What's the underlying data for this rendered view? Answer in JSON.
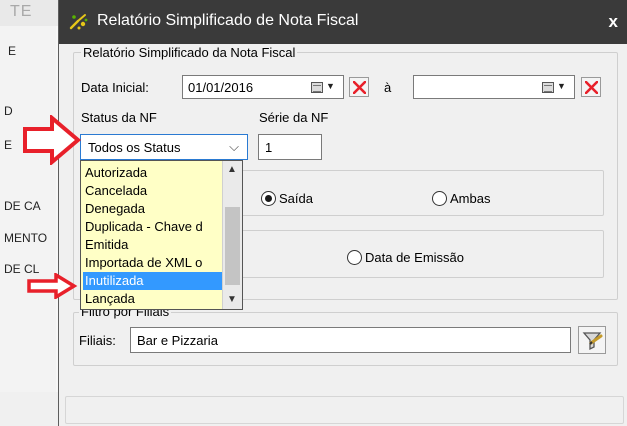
{
  "background": {
    "top_label": "TE",
    "items": [
      "E",
      "D",
      "E",
      "DE CA",
      "MENTO",
      "DE CL"
    ]
  },
  "dialog": {
    "title": "Relatório Simplificado de Nota Fiscal",
    "close_glyph": "x",
    "group_title": "Relatório Simplificado da Nota Fiscal",
    "data_inicial_label": "Data Inicial:",
    "data_inicial_value": "01/01/2016",
    "a_label": "à",
    "data_final_value": "",
    "status_label": "Status da NF",
    "status_selected": "Todos os Status",
    "serie_label": "Série da NF",
    "serie_value": "1",
    "status_options": [
      "Autorizada",
      "Cancelada",
      "Denegada",
      "Duplicada - Chave d",
      "Emitida",
      "Importada de XML o",
      "Inutilizada",
      "Lançada"
    ],
    "highlighted_option": "Inutilizada",
    "radio_saida": "Saída",
    "radio_ambas": "Ambas",
    "radio_data_emissao": "Data de Emissão",
    "filtro_title": "Filtro por Filiais",
    "filiais_label": "Filiais:",
    "filiais_value": "Bar e Pizzaria"
  },
  "colors": {
    "titlebar": "#3a3a3a",
    "dialog_bg": "#f0f0f0",
    "listbox_bg": "#ffffc6",
    "selection": "#3399ff",
    "annotation_arrow": "#e8202a",
    "delete_x": "#e8202a"
  },
  "icons": [
    "app-logo-icon",
    "close-icon",
    "calendar-icon",
    "dropdown-arrow-icon",
    "clear-x-icon",
    "chevron-down-icon",
    "scroll-up-icon",
    "scroll-down-icon",
    "filter-icon",
    "annotation-arrow-icon"
  ]
}
